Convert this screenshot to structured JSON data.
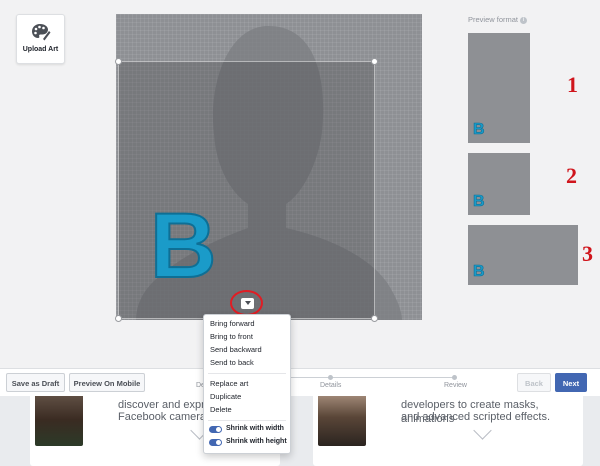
{
  "toolbar": {
    "upload_label": "Upload Art"
  },
  "context_menu": {
    "items": [
      "Bring forward",
      "Bring to front",
      "Send backward",
      "Send to back",
      "Replace art",
      "Duplicate",
      "Delete"
    ],
    "toggles": [
      {
        "label": "Shrink with width",
        "on": true
      },
      {
        "label": "Shrink with height",
        "on": true
      }
    ]
  },
  "preview": {
    "title": "Preview format",
    "info_icon": "info-icon",
    "annotations": [
      "1",
      "2",
      "3"
    ],
    "logo_letter": "B"
  },
  "canvas": {
    "logo_letter": "B",
    "colors": {
      "canvas": "#8e9094",
      "logo": "#1a9bc9",
      "annotation": "#e01d24"
    }
  },
  "footer": {
    "save_draft": "Save as Draft",
    "preview_mobile": "Preview On Mobile",
    "steps": [
      "De",
      "Details",
      "Review"
    ],
    "back": "Back",
    "next": "Next"
  },
  "background": {
    "card1_text": [
      "discover and express",
      "Facebook camera"
    ],
    "card2_text": [
      "developers to create masks, animations",
      "and advanced scripted effects."
    ]
  }
}
